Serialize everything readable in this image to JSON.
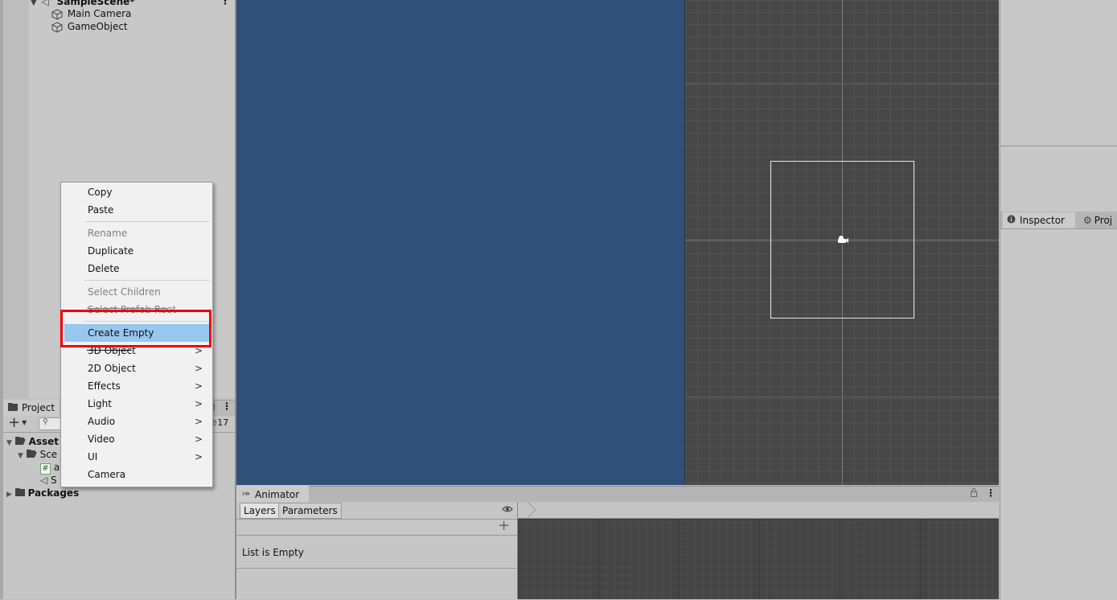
{
  "hierarchy": {
    "scene_name": "SampleScene*",
    "items": [
      "Main Camera",
      "GameObject"
    ]
  },
  "context_menu": {
    "items": [
      {
        "label": "Copy",
        "disabled": false,
        "submenu": false
      },
      {
        "label": "Paste",
        "disabled": false,
        "submenu": false
      },
      {
        "label": "Rename",
        "disabled": true,
        "submenu": false
      },
      {
        "label": "Duplicate",
        "disabled": false,
        "submenu": false
      },
      {
        "label": "Delete",
        "disabled": false,
        "submenu": false
      },
      {
        "label": "Select Children",
        "disabled": true,
        "submenu": false
      },
      {
        "label": "Select Prefab Root",
        "disabled": true,
        "submenu": false
      },
      {
        "label": "Create Empty",
        "disabled": false,
        "submenu": false,
        "highlighted": true
      },
      {
        "label": "3D Object",
        "disabled": false,
        "submenu": true
      },
      {
        "label": "2D Object",
        "disabled": false,
        "submenu": true
      },
      {
        "label": "Effects",
        "disabled": false,
        "submenu": true
      },
      {
        "label": "Light",
        "disabled": false,
        "submenu": true
      },
      {
        "label": "Audio",
        "disabled": false,
        "submenu": true
      },
      {
        "label": "Video",
        "disabled": false,
        "submenu": true
      },
      {
        "label": "UI",
        "disabled": false,
        "submenu": true
      },
      {
        "label": "Camera",
        "disabled": false,
        "submenu": false
      }
    ],
    "submenu_arrow": ">"
  },
  "project": {
    "tab_label": "Project",
    "add_label": "+",
    "count": "17",
    "tree": {
      "assets": "Asset",
      "scenes": "Sce",
      "script_item": "a",
      "scene_item": "S",
      "packages": "Packages"
    }
  },
  "inspector": {
    "tab_label": "Inspector",
    "second_tab_label": "Proj"
  },
  "animator": {
    "tab_label": "Animator",
    "layers_tab": "Layers",
    "parameters_tab": "Parameters",
    "empty_text": "List is Empty",
    "add_label": "+"
  },
  "colors": {
    "game_view_bg": "#30507a",
    "scene_view_bg": "#474747",
    "menu_highlight": "#98c8f0",
    "annotation_red": "#f20000"
  }
}
